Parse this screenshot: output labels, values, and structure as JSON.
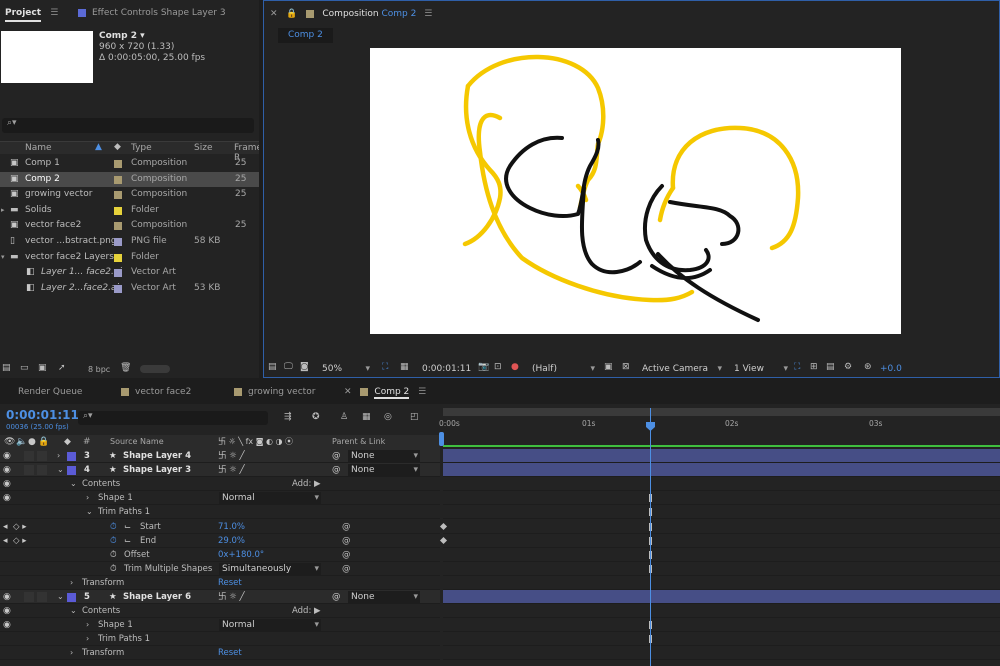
{
  "project_panel": {
    "tab_project": "Project",
    "tab_effect_controls": "Effect Controls Shape Layer 3",
    "selected_name": "Comp 2 ▾",
    "selected_dims": "960 x 720 (1.33)",
    "selected_duration": "Δ 0:00:05:00, 25.00 fps",
    "columns": {
      "name": "Name",
      "type": "Type",
      "size": "Size",
      "frame": "Frame R"
    },
    "items": [
      {
        "name": "Comp 1",
        "type": "Composition",
        "size": "",
        "frame": "25",
        "color": "#a89a70",
        "selected": false
      },
      {
        "name": "Comp 2",
        "type": "Composition",
        "size": "",
        "frame": "25",
        "color": "#a89a70",
        "selected": true
      },
      {
        "name": "growing vector",
        "type": "Composition",
        "size": "",
        "frame": "25",
        "color": "#a89a70",
        "selected": false
      },
      {
        "name": "Solids",
        "type": "Folder",
        "size": "",
        "frame": "",
        "color": "#e6d23b",
        "selected": false
      },
      {
        "name": "vector face2",
        "type": "Composition",
        "size": "",
        "frame": "25",
        "color": "#a89a70",
        "selected": false
      },
      {
        "name": "vector ...bstract.png",
        "type": "PNG file",
        "size": "58 KB",
        "frame": "",
        "color": "#9a9ac8",
        "selected": false
      },
      {
        "name": "vector face2 Layers",
        "type": "Folder",
        "size": "",
        "frame": "",
        "color": "#e6d23b",
        "selected": false
      },
      {
        "name": "Layer 1... face2.ai",
        "type": "Vector Art",
        "size": "",
        "frame": "",
        "color": "#9a9ac8",
        "selected": false
      },
      {
        "name": "Layer 2...face2.ai",
        "type": "Vector Art",
        "size": "53 KB",
        "frame": "",
        "color": "#9a9ac8",
        "selected": false
      }
    ],
    "bpc": "8 bpc"
  },
  "composition_panel": {
    "tab_label": "Composition",
    "tab_comp_name": "Comp 2",
    "breadcrumb": "Comp 2",
    "zoom": "50%",
    "timecode": "0:00:01:11",
    "resolution": "(Half)",
    "camera": "Active Camera",
    "views": "1 View",
    "exposure": "+0.0"
  },
  "timeline_tabs": [
    {
      "label": "Render Queue",
      "color": ""
    },
    {
      "label": "vector face2",
      "color": "#a89a70"
    },
    {
      "label": "growing vector",
      "color": "#a89a70"
    },
    {
      "label": "Comp 2",
      "color": "#a89a70"
    }
  ],
  "timeline": {
    "current_time": "0:00:01:11",
    "frame_info": "00036 (25.00 fps)",
    "col_source_name": "Source Name",
    "col_parent": "Parent & Link",
    "ruler": [
      "0:00s",
      "01s",
      "02s",
      "03s"
    ],
    "playhead_time_s": 1.44,
    "rows": [
      {
        "kind": "layer",
        "num": "3",
        "name": "Shape Layer 4",
        "parent": "None",
        "label_color": "#5b5bd6"
      },
      {
        "kind": "layer",
        "num": "4",
        "name": "Shape Layer 3",
        "parent": "None",
        "label_color": "#5b5bd6"
      },
      {
        "kind": "prop",
        "indent": 1,
        "name": "Contents",
        "extra": "Add:"
      },
      {
        "kind": "prop",
        "indent": 2,
        "name": "Shape 1",
        "value": "Normal",
        "dropdown": true
      },
      {
        "kind": "prop",
        "indent": 2,
        "name": "Trim Paths 1"
      },
      {
        "kind": "prop",
        "indent": 3,
        "name": "Start",
        "value": "71.0%",
        "keyed": true
      },
      {
        "kind": "prop",
        "indent": 3,
        "name": "End",
        "value": "29.0%",
        "keyed": true
      },
      {
        "kind": "prop",
        "indent": 3,
        "name": "Offset",
        "value": "0x+180.0°"
      },
      {
        "kind": "prop",
        "indent": 3,
        "name": "Trim Multiple Shapes",
        "value": "Simultaneously",
        "dropdown": true
      },
      {
        "kind": "prop",
        "indent": 1,
        "name": "Transform",
        "value": "Reset"
      },
      {
        "kind": "layer",
        "num": "5",
        "name": "Shape Layer 6",
        "parent": "None",
        "label_color": "#5b5bd6"
      },
      {
        "kind": "prop",
        "indent": 1,
        "name": "Contents",
        "extra": "Add:"
      },
      {
        "kind": "prop",
        "indent": 2,
        "name": "Shape 1",
        "value": "Normal",
        "dropdown": true
      },
      {
        "kind": "prop",
        "indent": 2,
        "name": "Trim Paths 1"
      },
      {
        "kind": "prop",
        "indent": 1,
        "name": "Transform",
        "value": "Reset"
      }
    ]
  },
  "colors": {
    "accent_blue": "#4d8fe3",
    "layer_bar": "#464e86",
    "yellow_stroke": "#f5c800",
    "black_stroke": "#111111"
  }
}
